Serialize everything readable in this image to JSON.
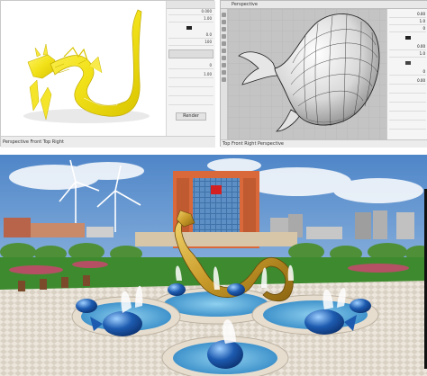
{
  "left_window": {
    "panel_header": "",
    "panel_values": [
      "0.000",
      "1.00",
      "0.0",
      "100",
      "0",
      "1.00"
    ],
    "panel_button": "Render",
    "status_text": "Perspective  Front  Top  Right"
  },
  "right_window": {
    "tab_label": "Perspective",
    "panel_values": [
      "0.00",
      "1.0",
      "0",
      "0.00",
      "1.0",
      "0",
      "0.00"
    ],
    "status_text": "Top  Front  Right  Perspective"
  },
  "render": {
    "building_sign": ""
  },
  "colors": {
    "dragon_yellow": "#f2e21a",
    "dragon_gold": "#c89a2a",
    "sky_top": "#4f86c8",
    "sky_bottom": "#b9d4ee",
    "water_blue": "#56a7d8",
    "whale_blue": "#1d5bb0",
    "building_orange": "#d9683a",
    "grass_green": "#3e8a2f",
    "pavement": "#e9e3da"
  }
}
